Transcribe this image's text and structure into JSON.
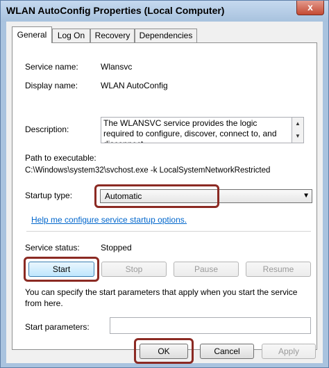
{
  "window": {
    "title": "WLAN AutoConfig Properties (Local Computer)",
    "close_glyph": "x"
  },
  "tabs": [
    {
      "label": "General"
    },
    {
      "label": "Log On"
    },
    {
      "label": "Recovery"
    },
    {
      "label": "Dependencies"
    }
  ],
  "general": {
    "service_name_label": "Service name:",
    "service_name_value": "Wlansvc",
    "display_name_label": "Display name:",
    "display_name_value": "WLAN AutoConfig",
    "description_label": "Description:",
    "description_value": "The WLANSVC service provides the logic required to configure, discover, connect to, and disconnect",
    "path_label": "Path to executable:",
    "path_value": "C:\\Windows\\system32\\svchost.exe -k LocalSystemNetworkRestricted",
    "startup_type_label": "Startup type:",
    "startup_type_value": "Automatic",
    "help_link": "Help me configure service startup options.",
    "service_status_label": "Service status:",
    "service_status_value": "Stopped",
    "buttons": {
      "start": "Start",
      "stop": "Stop",
      "pause": "Pause",
      "resume": "Resume"
    },
    "start_params_note": "You can specify the start parameters that apply when you start the service from here.",
    "start_params_label": "Start parameters:",
    "start_params_value": ""
  },
  "footer": {
    "ok": "OK",
    "cancel": "Cancel",
    "apply": "Apply"
  },
  "colors": {
    "highlight": "#8b2a23",
    "link": "#0066cc"
  }
}
